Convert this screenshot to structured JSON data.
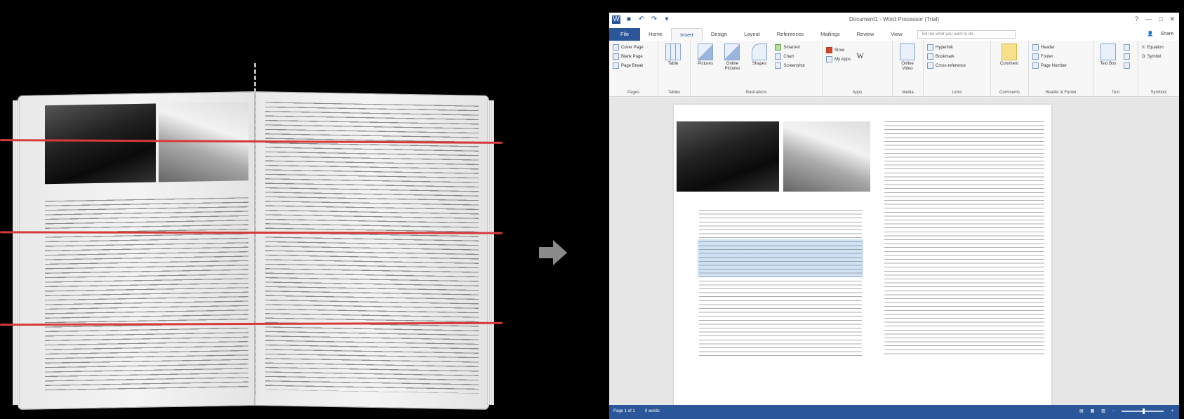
{
  "window": {
    "title": "Document1 - Word Processor (Trial)",
    "qat_icons": [
      "word-app-icon",
      "save-icon",
      "undo-icon",
      "redo-icon",
      "customize-icon"
    ],
    "controls": [
      "?",
      "—",
      "□",
      "✕"
    ]
  },
  "tabs": [
    {
      "label": "File"
    },
    {
      "label": "Home"
    },
    {
      "label": "Insert"
    },
    {
      "label": "Design"
    },
    {
      "label": "Layout"
    },
    {
      "label": "References"
    },
    {
      "label": "Mailings"
    },
    {
      "label": "Review"
    },
    {
      "label": "View"
    }
  ],
  "tell_me_placeholder": "Tell me what you want to do...",
  "account": {
    "share": "Share"
  },
  "ribbon": {
    "pages": {
      "label": "Pages",
      "items": [
        "Cover Page",
        "Blank Page",
        "Page Break"
      ]
    },
    "tables": {
      "label": "Tables",
      "table": "Table"
    },
    "illustrations": {
      "label": "Illustrations",
      "pictures": "Pictures",
      "online_pictures": "Online Pictures",
      "shapes": "Shapes",
      "smartart": "SmartArt",
      "chart": "Chart",
      "screenshot": "Screenshot"
    },
    "apps": {
      "label": "Apps",
      "store": "Store",
      "my_apps": "My Apps"
    },
    "media": {
      "label": "Media",
      "online_video": "Online Video"
    },
    "links": {
      "label": "Links",
      "hyperlink": "Hyperlink",
      "bookmark": "Bookmark",
      "cross_reference": "Cross-reference"
    },
    "comments": {
      "label": "Comments",
      "comment": "Comment"
    },
    "header_footer": {
      "label": "Header & Footer",
      "header": "Header",
      "footer": "Footer",
      "page_number": "Page Number"
    },
    "text": {
      "label": "Text",
      "text_box": "Text Box"
    },
    "symbols": {
      "label": "Symbols",
      "equation": "Equation",
      "symbol": "Symbol"
    }
  },
  "status": {
    "page": "Page 1 of 1",
    "words": "0 words"
  }
}
